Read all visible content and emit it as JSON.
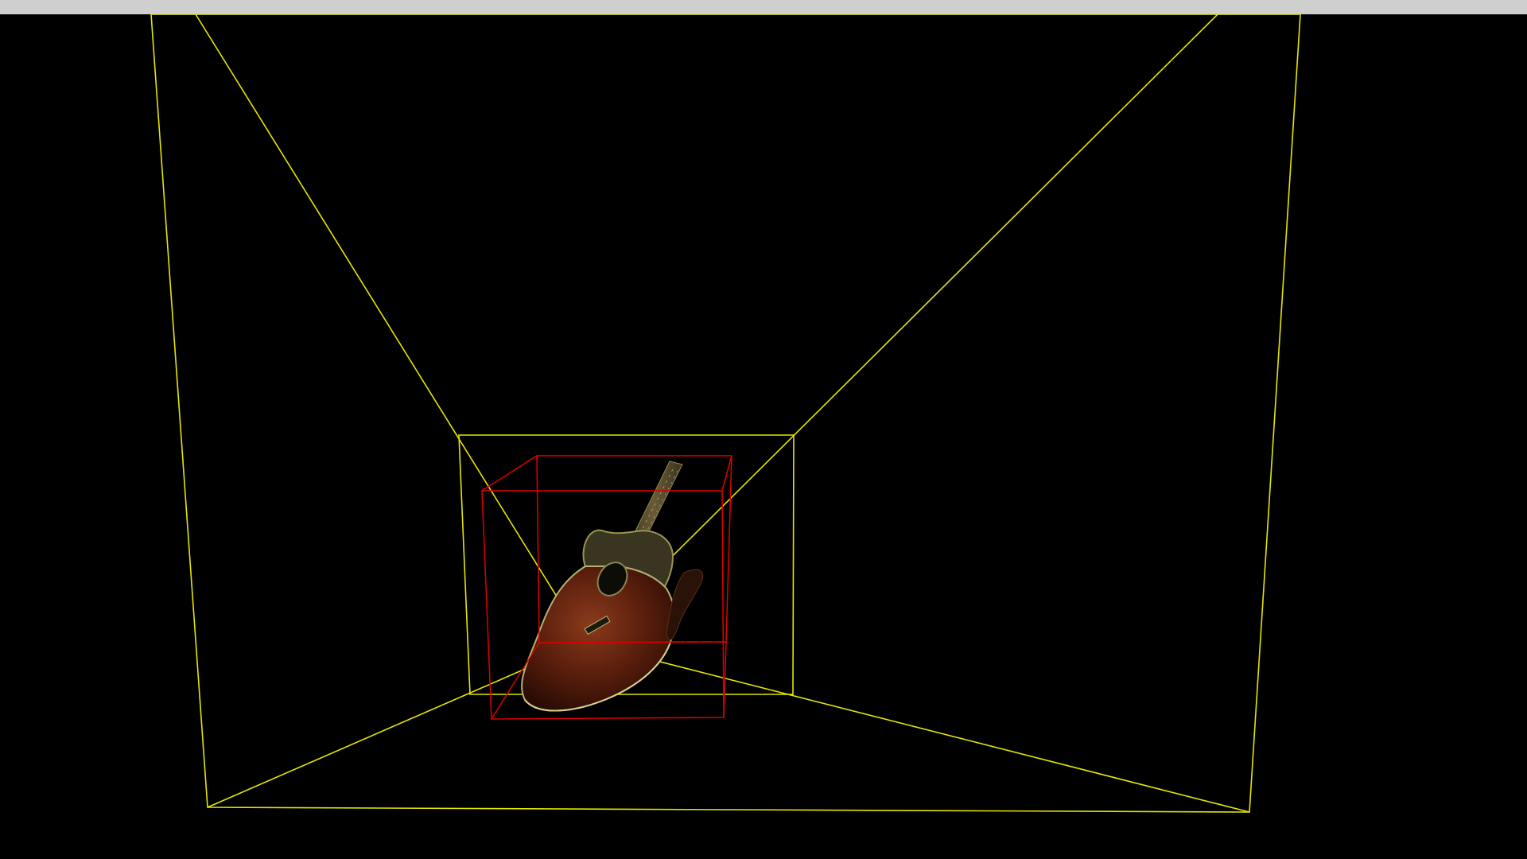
{
  "window": {
    "title": ""
  },
  "scene": {
    "background_color": "#000000",
    "camera_frustum_color": "#ffff00",
    "bounding_box_color": "#ff0000",
    "object": "acoustic-guitar-point-cloud"
  }
}
